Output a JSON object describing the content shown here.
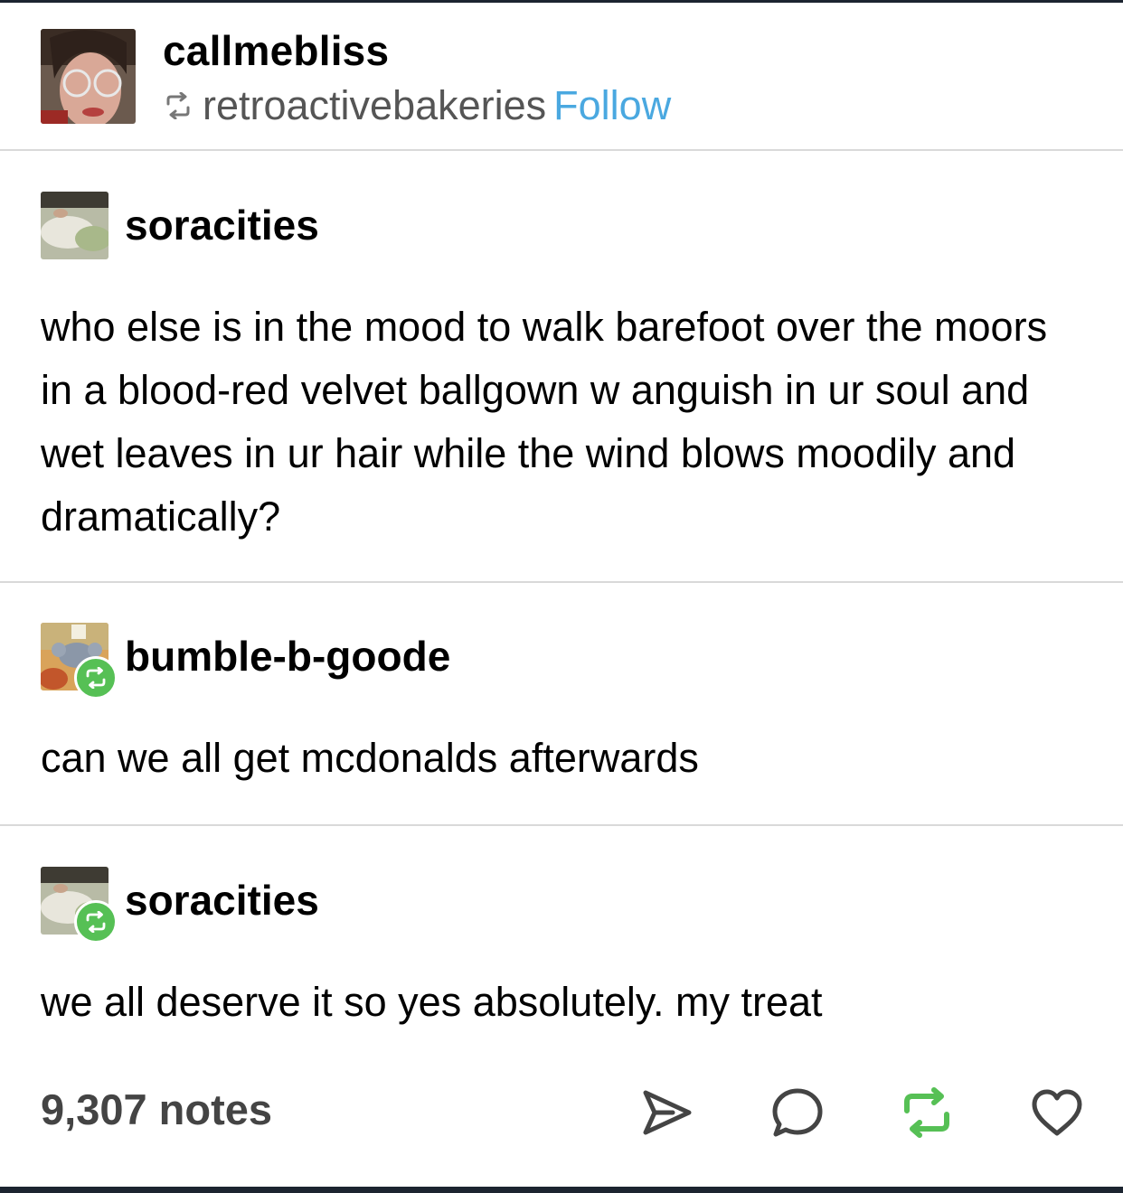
{
  "post": {
    "poster": "callmebliss",
    "reblogged_from": "retroactivebakeries",
    "follow_label": "Follow"
  },
  "thread": [
    {
      "username": "soracities",
      "text": "who else is in the mood to walk barefoot over the moors in a blood-red velvet ballgown w anguish in ur soul and wet leaves in ur hair while the wind blows moodily and dramatically?"
    },
    {
      "username": "bumble-b-goode",
      "text": "can we all get mcdonalds afterwards"
    },
    {
      "username": "soracities",
      "text": "we all deserve it so yes absolutely. my treat"
    }
  ],
  "footer": {
    "notes": "9,307 notes"
  },
  "icons": {
    "reblog": "reblog-icon",
    "share": "share-icon",
    "reply": "reply-icon",
    "like": "heart-icon"
  },
  "colors": {
    "follow": "#4aa8e0",
    "reblog_green": "#56c055",
    "border_dark": "#1c2430",
    "divider": "#d9d9d9"
  }
}
